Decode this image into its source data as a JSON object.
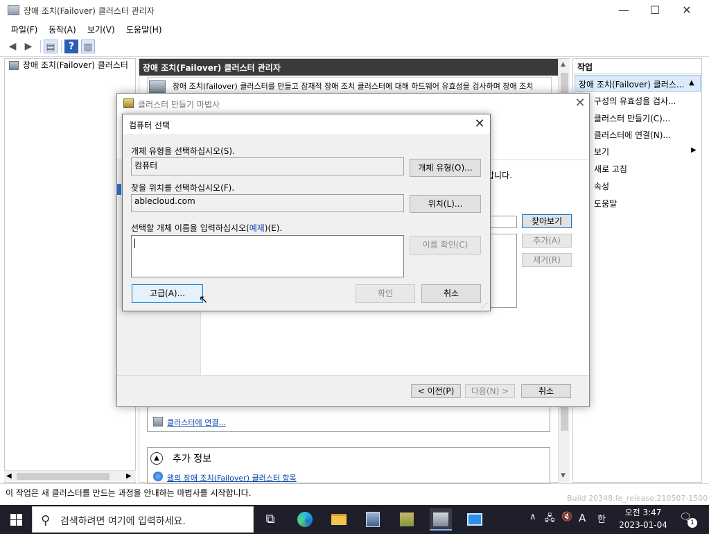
{
  "window": {
    "title": "장애 조치(Failover) 클러스터 관리자",
    "minimize": "—",
    "maximize": "☐",
    "close": "✕"
  },
  "menu": [
    "파일(F)",
    "동작(A)",
    "보기(V)",
    "도움말(H)"
  ],
  "tree": {
    "root_label": "장애 조치(Failover) 클러스터"
  },
  "center": {
    "header": "장애 조치(Failover) 클러스터 관리자",
    "intro": "장애 조치(failover) 클러스터를 만들고 잠재적 장애 조치 클러스터에 대해 하드웨어 유효성을 검사하며 장애 조치",
    "connect_link": "클러스터에 연결...",
    "more_info_title": "추가 정보",
    "web_link": "웹의 장애 조치(Failover) 클러스터 항목"
  },
  "actions": {
    "header": "작업",
    "group": "장애 조치(Failover) 클러스...",
    "items": [
      "구성의 유효성을 검사...",
      "클러스터 만들기(C)...",
      "클러스터에 연결(N)...",
      "보기",
      "새로 고침",
      "속성",
      "도움말"
    ]
  },
  "status": "이 작업은 새 클러스터를 만드는 과정을 안내하는 마법사를 시작합니다.",
  "build_text": "Build 20348.fe_release.210507-1500",
  "wizard": {
    "title": "클러스터 만들기 마법사",
    "partial_text": "합니다.",
    "browse": "찾아보기",
    "add": "추가(A)",
    "remove": "제거(R)",
    "prev": "< 이전(P)",
    "next": "다음(N) >",
    "cancel": "취소"
  },
  "select_dialog": {
    "title": "컴퓨터 선택",
    "object_type_label": "개체 유형을 선택하십시오(S).",
    "object_type_value": "컴퓨터",
    "object_type_button": "개체 유형(O)...",
    "location_label": "찾을 위치를 선택하십시오(F).",
    "location_value": "ablecloud.com",
    "location_button": "위치(L)...",
    "names_label_pre": "선택할 개체 이름을 입력하십시오(",
    "names_label_link": "예제",
    "names_label_post": ")(E).",
    "check_names": "이름 확인(C)",
    "advanced": "고급(A)...",
    "ok": "확인",
    "cancel": "취소"
  },
  "taskbar": {
    "search_placeholder": "검색하려면 여기에 입력하세요.",
    "tray_ime": "A",
    "tray_lang": "한",
    "time": "오전 3:47",
    "date": "2023-01-04",
    "notification_count": "1"
  }
}
